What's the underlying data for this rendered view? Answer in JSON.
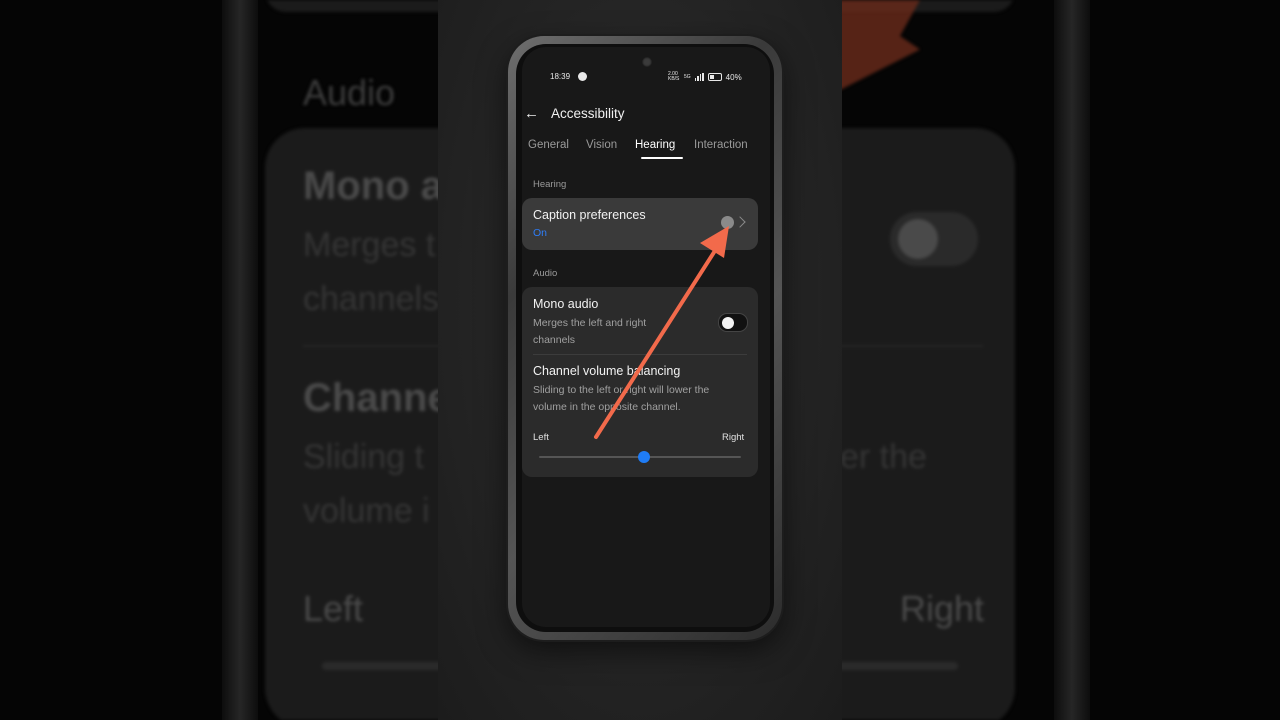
{
  "background": {
    "audio_label": "Audio",
    "mono_title": "Mono a",
    "mono_sub_1": "Merges t",
    "mono_sub_2": "channels",
    "channel_title": "Channe",
    "channel_sub_1": "Sliding t",
    "channel_sub_1b": "er the",
    "channel_sub_2": "volume i",
    "left_label": "Left",
    "right_label": "Right"
  },
  "status_bar": {
    "time": "18:39",
    "network": "2.00 KB/S",
    "signal": "5G",
    "battery": "40%"
  },
  "header": {
    "title": "Accessibility"
  },
  "tabs": [
    {
      "label": "General",
      "active": false
    },
    {
      "label": "Vision",
      "active": false
    },
    {
      "label": "Hearing",
      "active": true
    },
    {
      "label": "Interaction",
      "active": false
    }
  ],
  "hearing_section": {
    "label": "Hearing",
    "caption_title": "Caption preferences",
    "caption_status": "On"
  },
  "audio_section": {
    "label": "Audio",
    "mono_title": "Mono audio",
    "mono_description": "Merges the left and right channels",
    "mono_enabled": false,
    "balance_title": "Channel volume balancing",
    "balance_description": "Sliding to the left or right will lower the volume in the opposite channel.",
    "left_label": "Left",
    "right_label": "Right",
    "balance_value": 0.52
  },
  "colors": {
    "accent": "#1f7cf5",
    "annotation_arrow": "#f26a4b"
  }
}
